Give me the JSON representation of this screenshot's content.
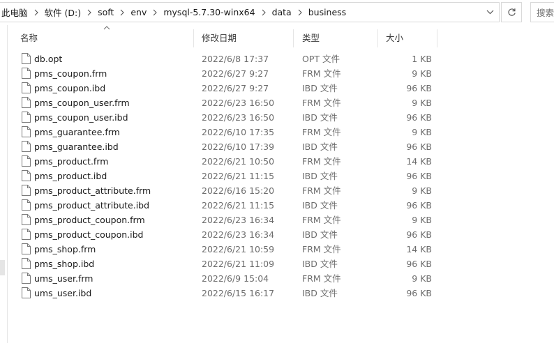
{
  "address_bar": {
    "crumbs": [
      "此电脑",
      "软件 (D:)",
      "soft",
      "env",
      "mysql-5.7.30-winx64",
      "data",
      "business"
    ]
  },
  "search": {
    "placeholder": "搜索"
  },
  "columns": {
    "name": "名称",
    "date": "修改日期",
    "type": "类型",
    "size": "大小"
  },
  "files": [
    {
      "name": "db.opt",
      "date": "2022/6/8 17:37",
      "type": "OPT 文件",
      "size": "1 KB"
    },
    {
      "name": "pms_coupon.frm",
      "date": "2022/6/27 9:27",
      "type": "FRM 文件",
      "size": "9 KB"
    },
    {
      "name": "pms_coupon.ibd",
      "date": "2022/6/27 9:27",
      "type": "IBD 文件",
      "size": "96 KB"
    },
    {
      "name": "pms_coupon_user.frm",
      "date": "2022/6/23 16:50",
      "type": "FRM 文件",
      "size": "9 KB"
    },
    {
      "name": "pms_coupon_user.ibd",
      "date": "2022/6/23 16:50",
      "type": "IBD 文件",
      "size": "96 KB"
    },
    {
      "name": "pms_guarantee.frm",
      "date": "2022/6/10 17:35",
      "type": "FRM 文件",
      "size": "9 KB"
    },
    {
      "name": "pms_guarantee.ibd",
      "date": "2022/6/10 17:39",
      "type": "IBD 文件",
      "size": "96 KB"
    },
    {
      "name": "pms_product.frm",
      "date": "2022/6/21 10:50",
      "type": "FRM 文件",
      "size": "14 KB"
    },
    {
      "name": "pms_product.ibd",
      "date": "2022/6/21 11:15",
      "type": "IBD 文件",
      "size": "96 KB"
    },
    {
      "name": "pms_product_attribute.frm",
      "date": "2022/6/16 15:20",
      "type": "FRM 文件",
      "size": "9 KB"
    },
    {
      "name": "pms_product_attribute.ibd",
      "date": "2022/6/21 11:15",
      "type": "IBD 文件",
      "size": "96 KB"
    },
    {
      "name": "pms_product_coupon.frm",
      "date": "2022/6/23 16:34",
      "type": "FRM 文件",
      "size": "9 KB"
    },
    {
      "name": "pms_product_coupon.ibd",
      "date": "2022/6/23 16:34",
      "type": "IBD 文件",
      "size": "96 KB"
    },
    {
      "name": "pms_shop.frm",
      "date": "2022/6/21 10:59",
      "type": "FRM 文件",
      "size": "14 KB"
    },
    {
      "name": "pms_shop.ibd",
      "date": "2022/6/21 11:09",
      "type": "IBD 文件",
      "size": "96 KB"
    },
    {
      "name": "ums_user.frm",
      "date": "2022/6/9 15:04",
      "type": "FRM 文件",
      "size": "9 KB"
    },
    {
      "name": "ums_user.ibd",
      "date": "2022/6/15 16:17",
      "type": "IBD 文件",
      "size": "96 KB"
    }
  ]
}
